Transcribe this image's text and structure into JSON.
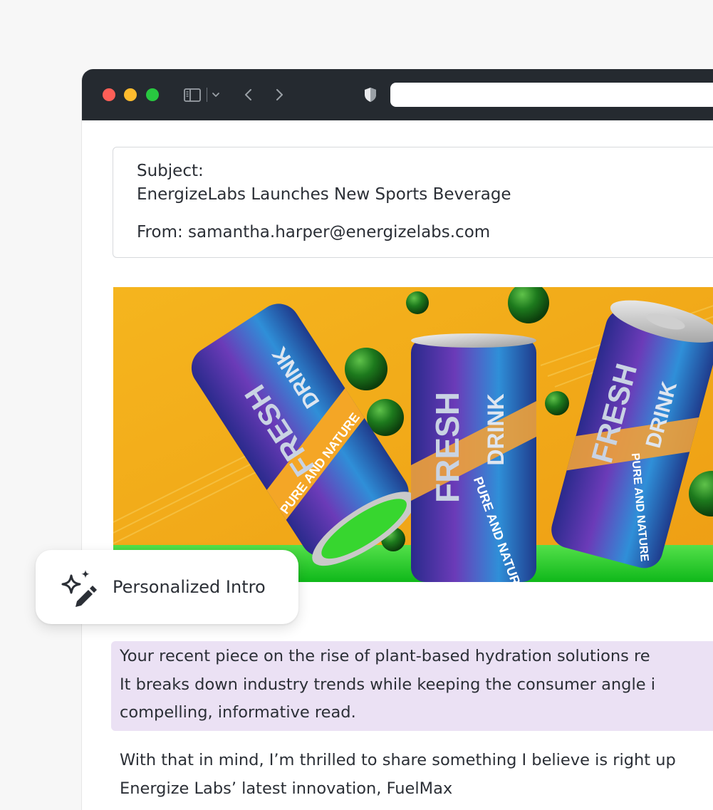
{
  "email": {
    "subject_label": "Subject:",
    "subject": "EnergizeLabs Launches New Sports Beverage",
    "from": "From: samantha.harper@energizelabs.com"
  },
  "hero": {
    "can_brand_1": "FRESH",
    "can_brand_2": "DRINK",
    "can_tagline": "PURE AND NATURE",
    "background_color": "#f1b21c",
    "floor_color": "#1fd11f"
  },
  "feature": {
    "label": "Personalized Intro",
    "icon": "sparkle-pen-icon"
  },
  "intro": {
    "lines": [
      "Your recent piece on the rise of plant-based hydration solutions re",
      "It breaks down industry trends while keeping the consumer angle i",
      "compelling, informative read."
    ],
    "highlight_color": "#ebe1f4"
  },
  "body": {
    "lines": [
      "With that in mind, I’m thrilled to share something I believe is right up",
      "Energize Labs’ latest innovation, FuelMax"
    ]
  },
  "browser": {
    "icons": [
      "sidebar-icon",
      "chevron-down-icon",
      "back-arrow-icon",
      "forward-arrow-icon",
      "shield-icon"
    ]
  }
}
